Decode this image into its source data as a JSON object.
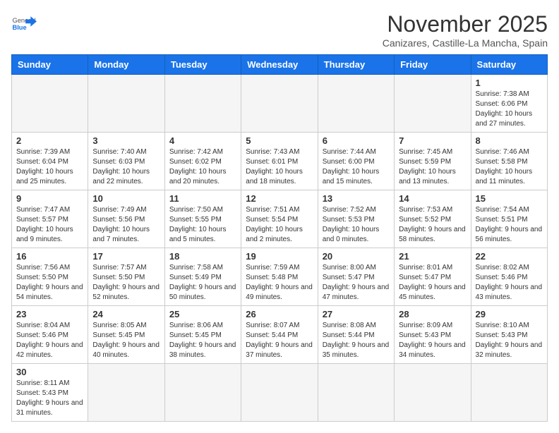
{
  "header": {
    "logo_general": "General",
    "logo_blue": "Blue",
    "month": "November 2025",
    "location": "Canizares, Castille-La Mancha, Spain"
  },
  "weekdays": [
    "Sunday",
    "Monday",
    "Tuesday",
    "Wednesday",
    "Thursday",
    "Friday",
    "Saturday"
  ],
  "weeks": [
    [
      {
        "day": "",
        "empty": true
      },
      {
        "day": "",
        "empty": true
      },
      {
        "day": "",
        "empty": true
      },
      {
        "day": "",
        "empty": true
      },
      {
        "day": "",
        "empty": true
      },
      {
        "day": "",
        "empty": true
      },
      {
        "day": "1",
        "info": "Sunrise: 7:38 AM\nSunset: 6:06 PM\nDaylight: 10 hours\nand 27 minutes."
      }
    ],
    [
      {
        "day": "2",
        "info": "Sunrise: 7:39 AM\nSunset: 6:04 PM\nDaylight: 10 hours\nand 25 minutes."
      },
      {
        "day": "3",
        "info": "Sunrise: 7:40 AM\nSunset: 6:03 PM\nDaylight: 10 hours\nand 22 minutes."
      },
      {
        "day": "4",
        "info": "Sunrise: 7:42 AM\nSunset: 6:02 PM\nDaylight: 10 hours\nand 20 minutes."
      },
      {
        "day": "5",
        "info": "Sunrise: 7:43 AM\nSunset: 6:01 PM\nDaylight: 10 hours\nand 18 minutes."
      },
      {
        "day": "6",
        "info": "Sunrise: 7:44 AM\nSunset: 6:00 PM\nDaylight: 10 hours\nand 15 minutes."
      },
      {
        "day": "7",
        "info": "Sunrise: 7:45 AM\nSunset: 5:59 PM\nDaylight: 10 hours\nand 13 minutes."
      },
      {
        "day": "8",
        "info": "Sunrise: 7:46 AM\nSunset: 5:58 PM\nDaylight: 10 hours\nand 11 minutes."
      }
    ],
    [
      {
        "day": "9",
        "info": "Sunrise: 7:47 AM\nSunset: 5:57 PM\nDaylight: 10 hours\nand 9 minutes."
      },
      {
        "day": "10",
        "info": "Sunrise: 7:49 AM\nSunset: 5:56 PM\nDaylight: 10 hours\nand 7 minutes."
      },
      {
        "day": "11",
        "info": "Sunrise: 7:50 AM\nSunset: 5:55 PM\nDaylight: 10 hours\nand 5 minutes."
      },
      {
        "day": "12",
        "info": "Sunrise: 7:51 AM\nSunset: 5:54 PM\nDaylight: 10 hours\nand 2 minutes."
      },
      {
        "day": "13",
        "info": "Sunrise: 7:52 AM\nSunset: 5:53 PM\nDaylight: 10 hours\nand 0 minutes."
      },
      {
        "day": "14",
        "info": "Sunrise: 7:53 AM\nSunset: 5:52 PM\nDaylight: 9 hours\nand 58 minutes."
      },
      {
        "day": "15",
        "info": "Sunrise: 7:54 AM\nSunset: 5:51 PM\nDaylight: 9 hours\nand 56 minutes."
      }
    ],
    [
      {
        "day": "16",
        "info": "Sunrise: 7:56 AM\nSunset: 5:50 PM\nDaylight: 9 hours\nand 54 minutes."
      },
      {
        "day": "17",
        "info": "Sunrise: 7:57 AM\nSunset: 5:50 PM\nDaylight: 9 hours\nand 52 minutes."
      },
      {
        "day": "18",
        "info": "Sunrise: 7:58 AM\nSunset: 5:49 PM\nDaylight: 9 hours\nand 50 minutes."
      },
      {
        "day": "19",
        "info": "Sunrise: 7:59 AM\nSunset: 5:48 PM\nDaylight: 9 hours\nand 49 minutes."
      },
      {
        "day": "20",
        "info": "Sunrise: 8:00 AM\nSunset: 5:47 PM\nDaylight: 9 hours\nand 47 minutes."
      },
      {
        "day": "21",
        "info": "Sunrise: 8:01 AM\nSunset: 5:47 PM\nDaylight: 9 hours\nand 45 minutes."
      },
      {
        "day": "22",
        "info": "Sunrise: 8:02 AM\nSunset: 5:46 PM\nDaylight: 9 hours\nand 43 minutes."
      }
    ],
    [
      {
        "day": "23",
        "info": "Sunrise: 8:04 AM\nSunset: 5:46 PM\nDaylight: 9 hours\nand 42 minutes."
      },
      {
        "day": "24",
        "info": "Sunrise: 8:05 AM\nSunset: 5:45 PM\nDaylight: 9 hours\nand 40 minutes."
      },
      {
        "day": "25",
        "info": "Sunrise: 8:06 AM\nSunset: 5:45 PM\nDaylight: 9 hours\nand 38 minutes."
      },
      {
        "day": "26",
        "info": "Sunrise: 8:07 AM\nSunset: 5:44 PM\nDaylight: 9 hours\nand 37 minutes."
      },
      {
        "day": "27",
        "info": "Sunrise: 8:08 AM\nSunset: 5:44 PM\nDaylight: 9 hours\nand 35 minutes."
      },
      {
        "day": "28",
        "info": "Sunrise: 8:09 AM\nSunset: 5:43 PM\nDaylight: 9 hours\nand 34 minutes."
      },
      {
        "day": "29",
        "info": "Sunrise: 8:10 AM\nSunset: 5:43 PM\nDaylight: 9 hours\nand 32 minutes."
      }
    ],
    [
      {
        "day": "30",
        "info": "Sunrise: 8:11 AM\nSunset: 5:43 PM\nDaylight: 9 hours\nand 31 minutes."
      },
      {
        "day": "",
        "empty": true
      },
      {
        "day": "",
        "empty": true
      },
      {
        "day": "",
        "empty": true
      },
      {
        "day": "",
        "empty": true
      },
      {
        "day": "",
        "empty": true
      },
      {
        "day": "",
        "empty": true
      }
    ]
  ]
}
